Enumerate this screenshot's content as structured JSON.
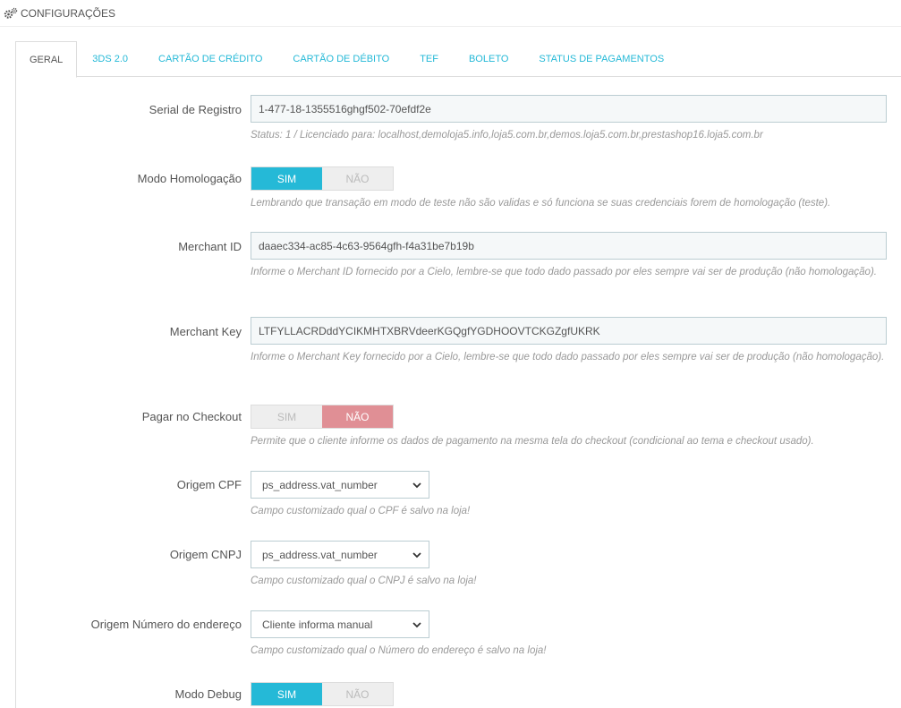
{
  "header": {
    "title": "CONFIGURAÇÕES",
    "icon": "gears-icon"
  },
  "tabs": [
    {
      "label": "GERAL",
      "active": true
    },
    {
      "label": "3DS 2.0",
      "active": false
    },
    {
      "label": "CARTÃO DE CRÉDITO",
      "active": false
    },
    {
      "label": "CARTÃO DE DÉBITO",
      "active": false
    },
    {
      "label": "TEF",
      "active": false
    },
    {
      "label": "BOLETO",
      "active": false
    },
    {
      "label": "STATUS DE PAGAMENTOS",
      "active": false
    }
  ],
  "form": {
    "serial": {
      "label": "Serial de Registro",
      "value": "1-477-18-1355516ghgf502-70efdf2e",
      "help": "Status: 1 / Licenciado para: localhost,demoloja5.info,loja5.com.br,demos.loja5.com.br,prestashop16.loja5.com.br"
    },
    "homologacao": {
      "label": "Modo Homologação",
      "yes": "SIM",
      "no": "NÃO",
      "selected": "yes",
      "help": "Lembrando que transação em modo de teste não são validas e só funciona se suas credenciais forem de homologação (teste)."
    },
    "merchant_id": {
      "label": "Merchant ID",
      "value": "daaec334-ac85-4c63-9564gfh-f4a31be7b19b",
      "help": "Informe o Merchant ID fornecido por a Cielo, lembre-se que todo dado passado por eles sempre vai ser de produção (não homologação)."
    },
    "merchant_key": {
      "label": "Merchant Key",
      "value": "LTFYLLACRDddYCIKMHTXBRVdeerKGQgfYGDHOOVTCKGZgfUKRK",
      "help": "Informe o Merchant Key fornecido por a Cielo, lembre-se que todo dado passado por eles sempre vai ser de produção (não homologação)."
    },
    "checkout": {
      "label": "Pagar no Checkout",
      "yes": "SIM",
      "no": "NÃO",
      "selected": "no",
      "help": "Permite que o cliente informe os dados de pagamento na mesma tela do checkout (condicional ao tema e checkout usado)."
    },
    "origem_cpf": {
      "label": "Origem CPF",
      "value": "ps_address.vat_number",
      "help": "Campo customizado qual o CPF é salvo na loja!"
    },
    "origem_cnpj": {
      "label": "Origem CNPJ",
      "value": "ps_address.vat_number",
      "help": "Campo customizado qual o CNPJ é salvo na loja!"
    },
    "origem_numero": {
      "label": "Origem Número do endereço",
      "value": "Cliente informa manual",
      "help": "Campo customizado qual o Número do endereço é salvo na loja!"
    },
    "debug": {
      "label": "Modo Debug",
      "yes": "SIM",
      "no": "NÃO",
      "selected": "yes"
    }
  },
  "colors": {
    "accent": "#25b9d7",
    "danger": "#e08f95",
    "border": "#bbcdd2"
  }
}
